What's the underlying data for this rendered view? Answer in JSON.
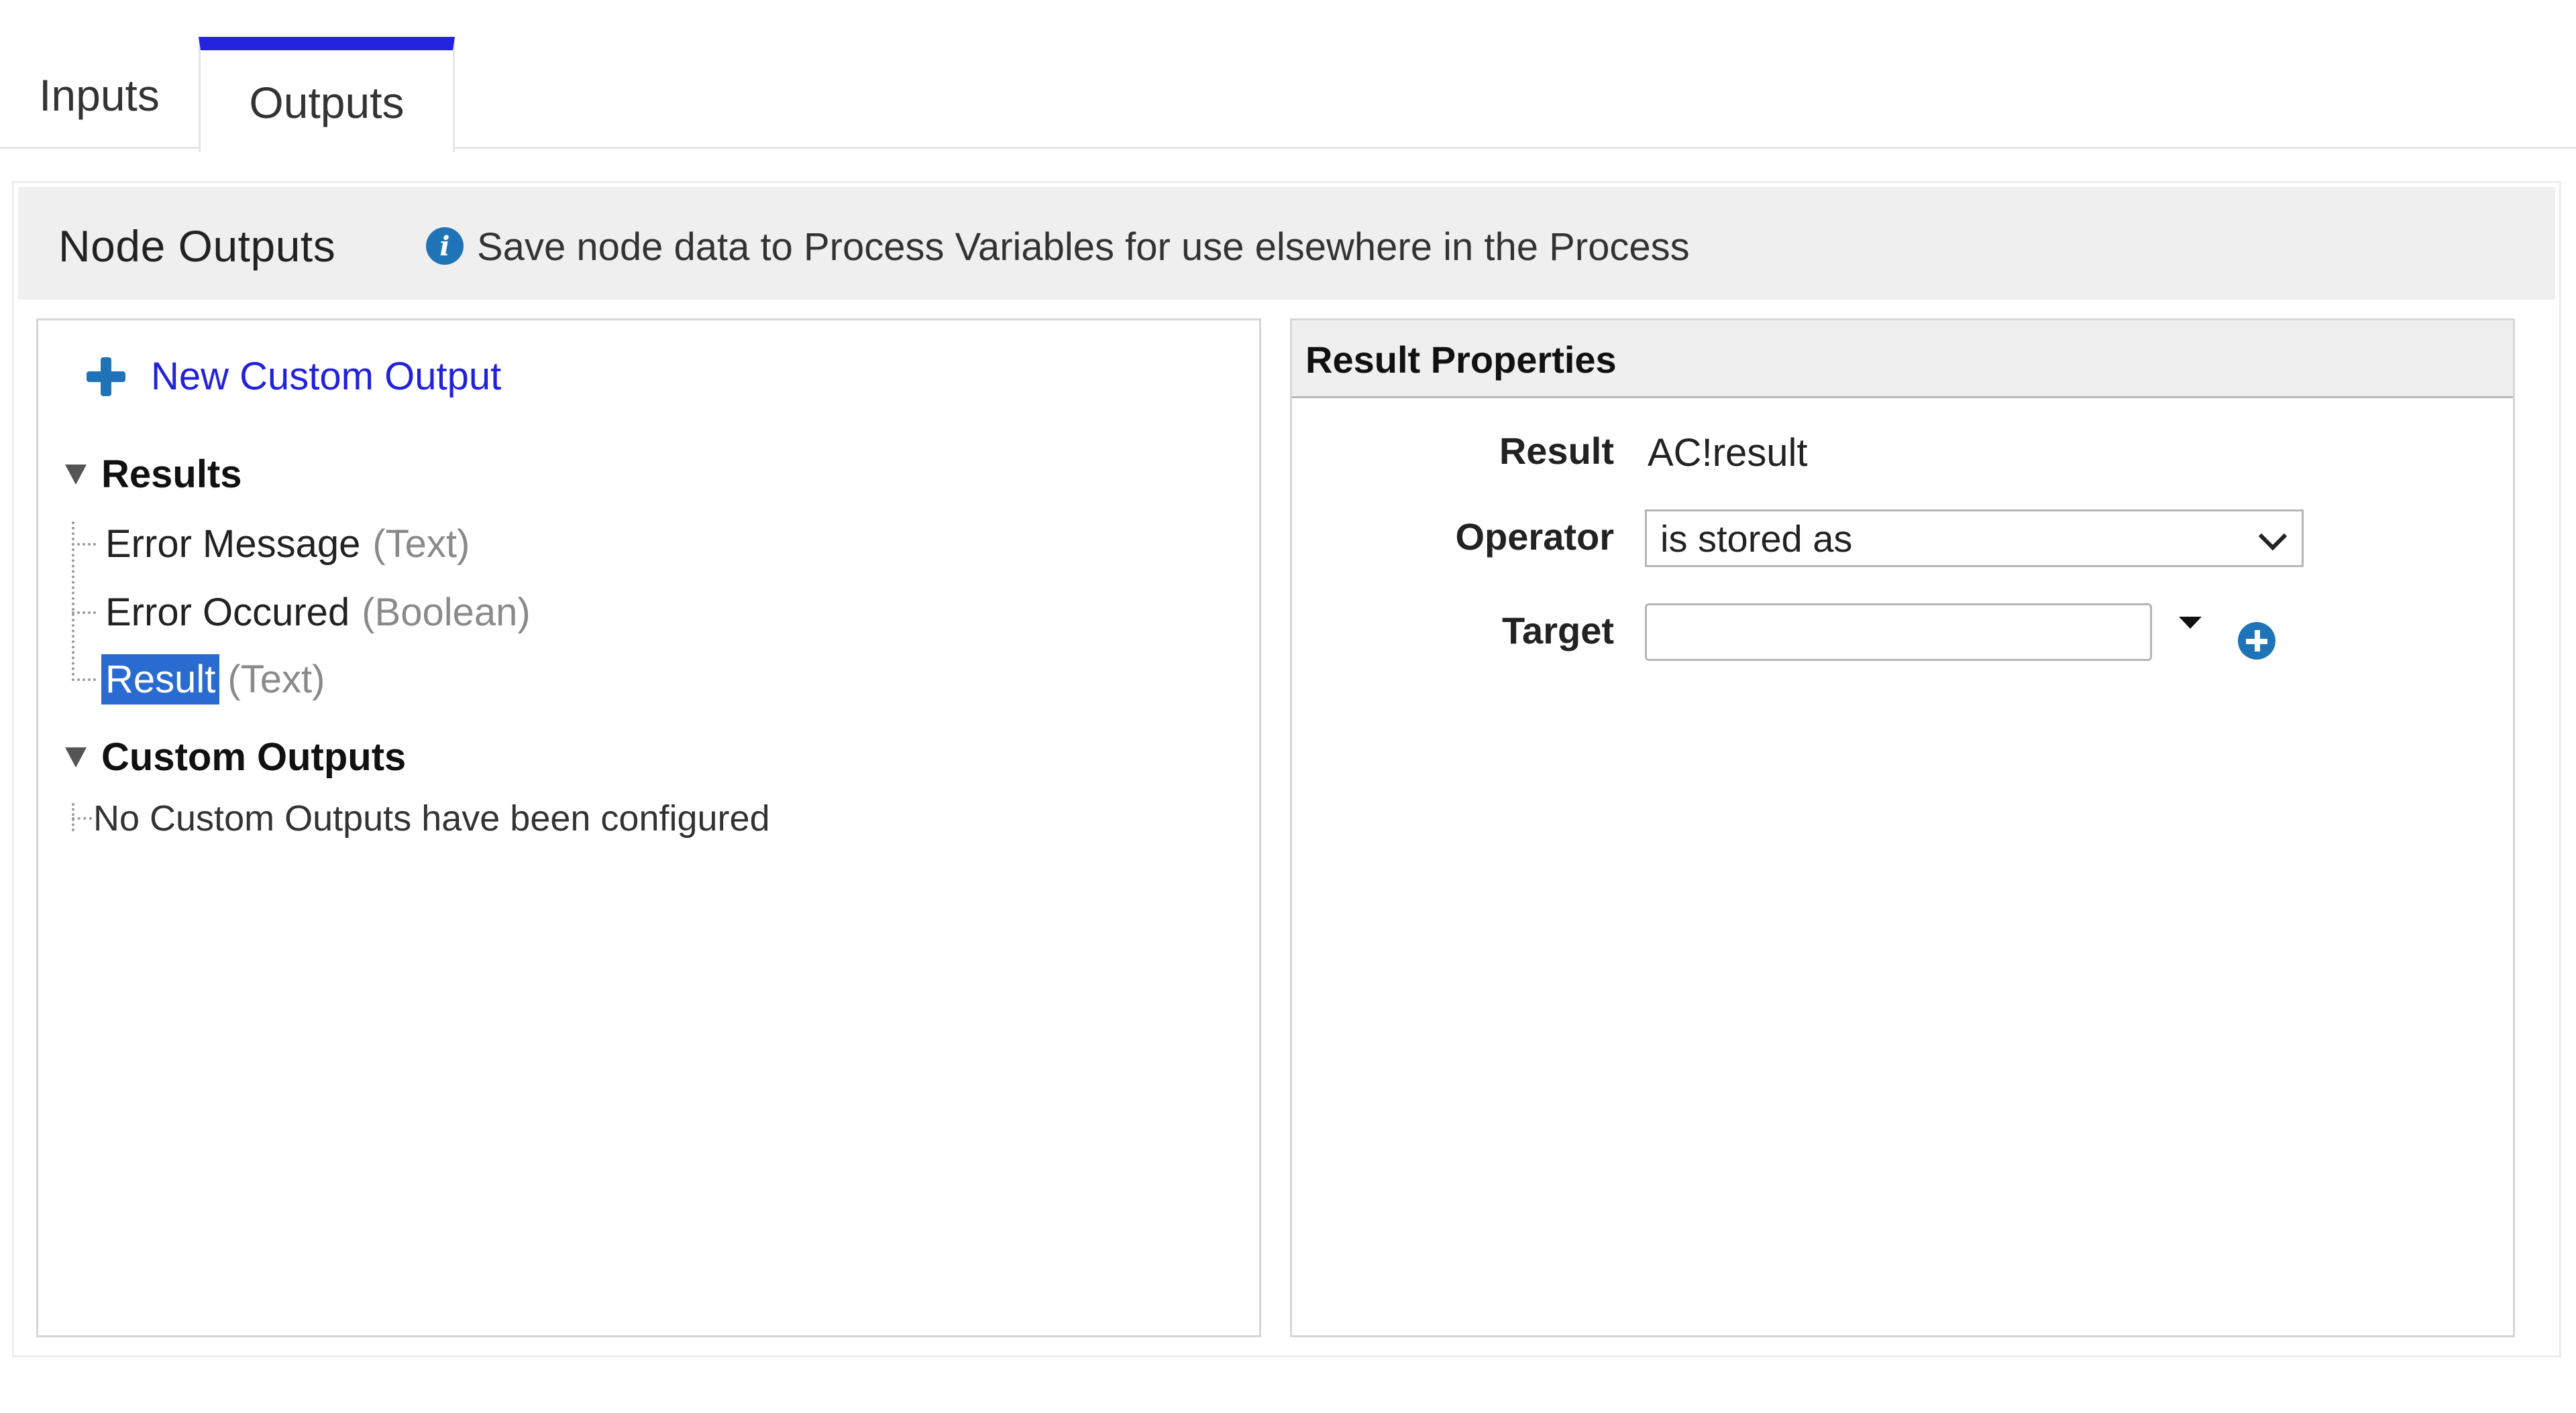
{
  "tabs": {
    "inputs_label": "Inputs",
    "outputs_label": "Outputs",
    "active": "Outputs"
  },
  "header": {
    "title": "Node Outputs",
    "info_icon": "info-icon",
    "description": "Save node data to Process Variables for use elsewhere in the Process"
  },
  "left": {
    "new_output_label": "New Custom Output",
    "new_output_icon": "plus-icon",
    "results_heading": "Results",
    "results": [
      {
        "name": "Error Message",
        "type": "(Text)",
        "selected": false
      },
      {
        "name": "Error Occured",
        "type": "(Boolean)",
        "selected": false
      },
      {
        "name": "Result",
        "type": "(Text)",
        "selected": true
      }
    ],
    "custom_heading": "Custom Outputs",
    "custom_empty": "No Custom Outputs have been configured"
  },
  "right": {
    "title": "Result Properties",
    "result_label": "Result",
    "result_value": "AC!result",
    "operator_label": "Operator",
    "operator_value": "is stored as",
    "target_label": "Target",
    "target_value": ""
  },
  "colors": {
    "accent_tab": "#2323e0",
    "link": "#2222dd",
    "icon_blue": "#1f73b7",
    "selection": "#2a6bd0"
  }
}
